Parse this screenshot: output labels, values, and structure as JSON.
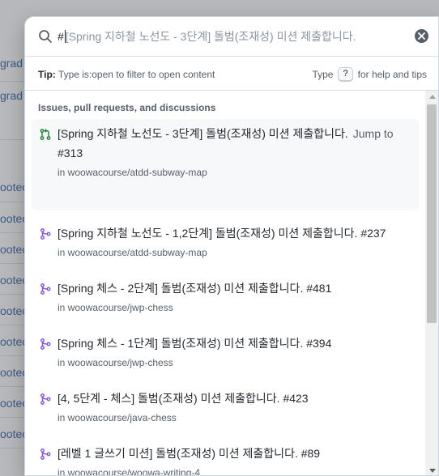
{
  "background_fragments": [
    "grad",
    "grad",
    "ootec",
    "ootec",
    "ootec",
    "ootec",
    "ootec",
    "ootec",
    "ootec",
    "ootec",
    "ootec"
  ],
  "search": {
    "typed": "#",
    "suggestion": "[Spring 지하철 노선도 - 3단계] 돌범(조재성) 미션 제출합니다."
  },
  "tip": {
    "label": "Tip:",
    "text": "Type is:open to filter to open content",
    "help_prefix": "Type",
    "help_key": "?",
    "help_suffix": "for help and tips"
  },
  "results": {
    "group_title": "Issues, pull requests, and discussions",
    "items": [
      {
        "title": "[Spring 지하철 노선도 - 3단계] 돌범(조재성) 미션 제출합니다.",
        "jump": "Jump to",
        "number": "#313",
        "repo": "in woowacourse/atdd-subway-map",
        "icon": "pull-request-open-icon"
      },
      {
        "title": "[Spring 지하철 노선도 - 1,2단계] 돌범(조재성) 미션 제출합니다.",
        "number": "#237",
        "repo": "in woowacourse/atdd-subway-map",
        "icon": "pull-request-merged-icon"
      },
      {
        "title": "[Spring 체스 - 2단계] 돌범(조재성) 미션 제출합니다.",
        "number": "#481",
        "repo": "in woowacourse/jwp-chess",
        "icon": "pull-request-merged-icon"
      },
      {
        "title": "[Spring 체스 - 1단계] 돌범(조재성) 미션 제출합니다.",
        "number": "#394",
        "repo": "in woowacourse/jwp-chess",
        "icon": "pull-request-merged-icon"
      },
      {
        "title": "[4, 5단계 - 체스] 돌범(조재성) 미션 제출합니다.",
        "number": "#423",
        "repo": "in woowacourse/java-chess",
        "icon": "pull-request-merged-icon"
      },
      {
        "title": "[레벨 1 글쓰기 미션] 돌범(조재성) 미션 제출합니다.",
        "number": "#89",
        "repo": "in woowacourse/woowa-writing-4",
        "icon": "pull-request-merged-icon"
      }
    ]
  },
  "colors": {
    "open": "#1a7f37",
    "merged": "#8250df"
  }
}
